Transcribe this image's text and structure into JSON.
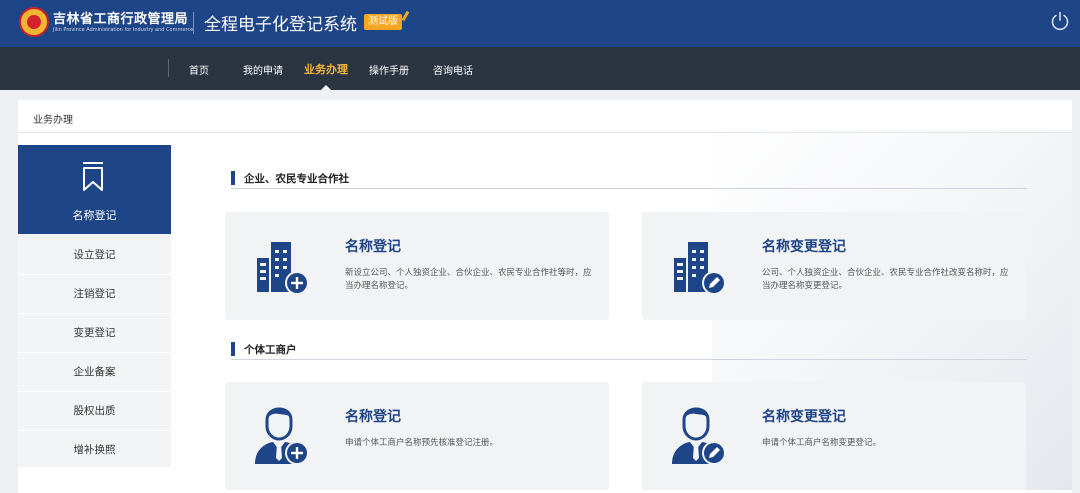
{
  "header": {
    "agency_name": "吉林省工商行政管理局",
    "agency_name_en": "Jilin Province Administration for Industry and Commerce",
    "system_title": "全程电子化登记系统",
    "test_badge": "测试版"
  },
  "nav": {
    "items": [
      {
        "label": "首页",
        "active": false
      },
      {
        "label": "我的申请",
        "active": false
      },
      {
        "label": "业务办理",
        "active": true
      },
      {
        "label": "操作手册",
        "active": false
      },
      {
        "label": "咨询电话",
        "active": false
      }
    ]
  },
  "breadcrumb": "业务办理",
  "sidebar": {
    "items": [
      {
        "label": "名称登记",
        "active": true
      },
      {
        "label": "设立登记",
        "active": false
      },
      {
        "label": "注销登记",
        "active": false
      },
      {
        "label": "变更登记",
        "active": false
      },
      {
        "label": "企业备案",
        "active": false
      },
      {
        "label": "股权出质",
        "active": false
      },
      {
        "label": "增补换照",
        "active": false
      }
    ]
  },
  "sections": [
    {
      "title": "企业、农民专业合作社",
      "cards": [
        {
          "title": "名称登记",
          "desc": "新设立公司、个人独资企业、合伙企业、农民专业合作社等时，应当办理名称登记。",
          "icon": "building-add-icon"
        },
        {
          "title": "名称变更登记",
          "desc": "公司、个人独资企业、合伙企业、农民专业合作社改变名称时，应当办理名称变更登记。",
          "icon": "building-edit-icon"
        }
      ]
    },
    {
      "title": "个体工商户",
      "cards": [
        {
          "title": "名称登记",
          "desc": "申请个体工商户名称预先核准登记注册。",
          "icon": "person-add-icon"
        },
        {
          "title": "名称变更登记",
          "desc": "申请个体工商户名称变更登记。",
          "icon": "person-edit-icon"
        }
      ]
    }
  ],
  "colors": {
    "brand_blue": "#1e4588",
    "nav_dark": "#2b3441",
    "nav_active": "#f3b53a",
    "badge_orange": "#f6a623"
  }
}
